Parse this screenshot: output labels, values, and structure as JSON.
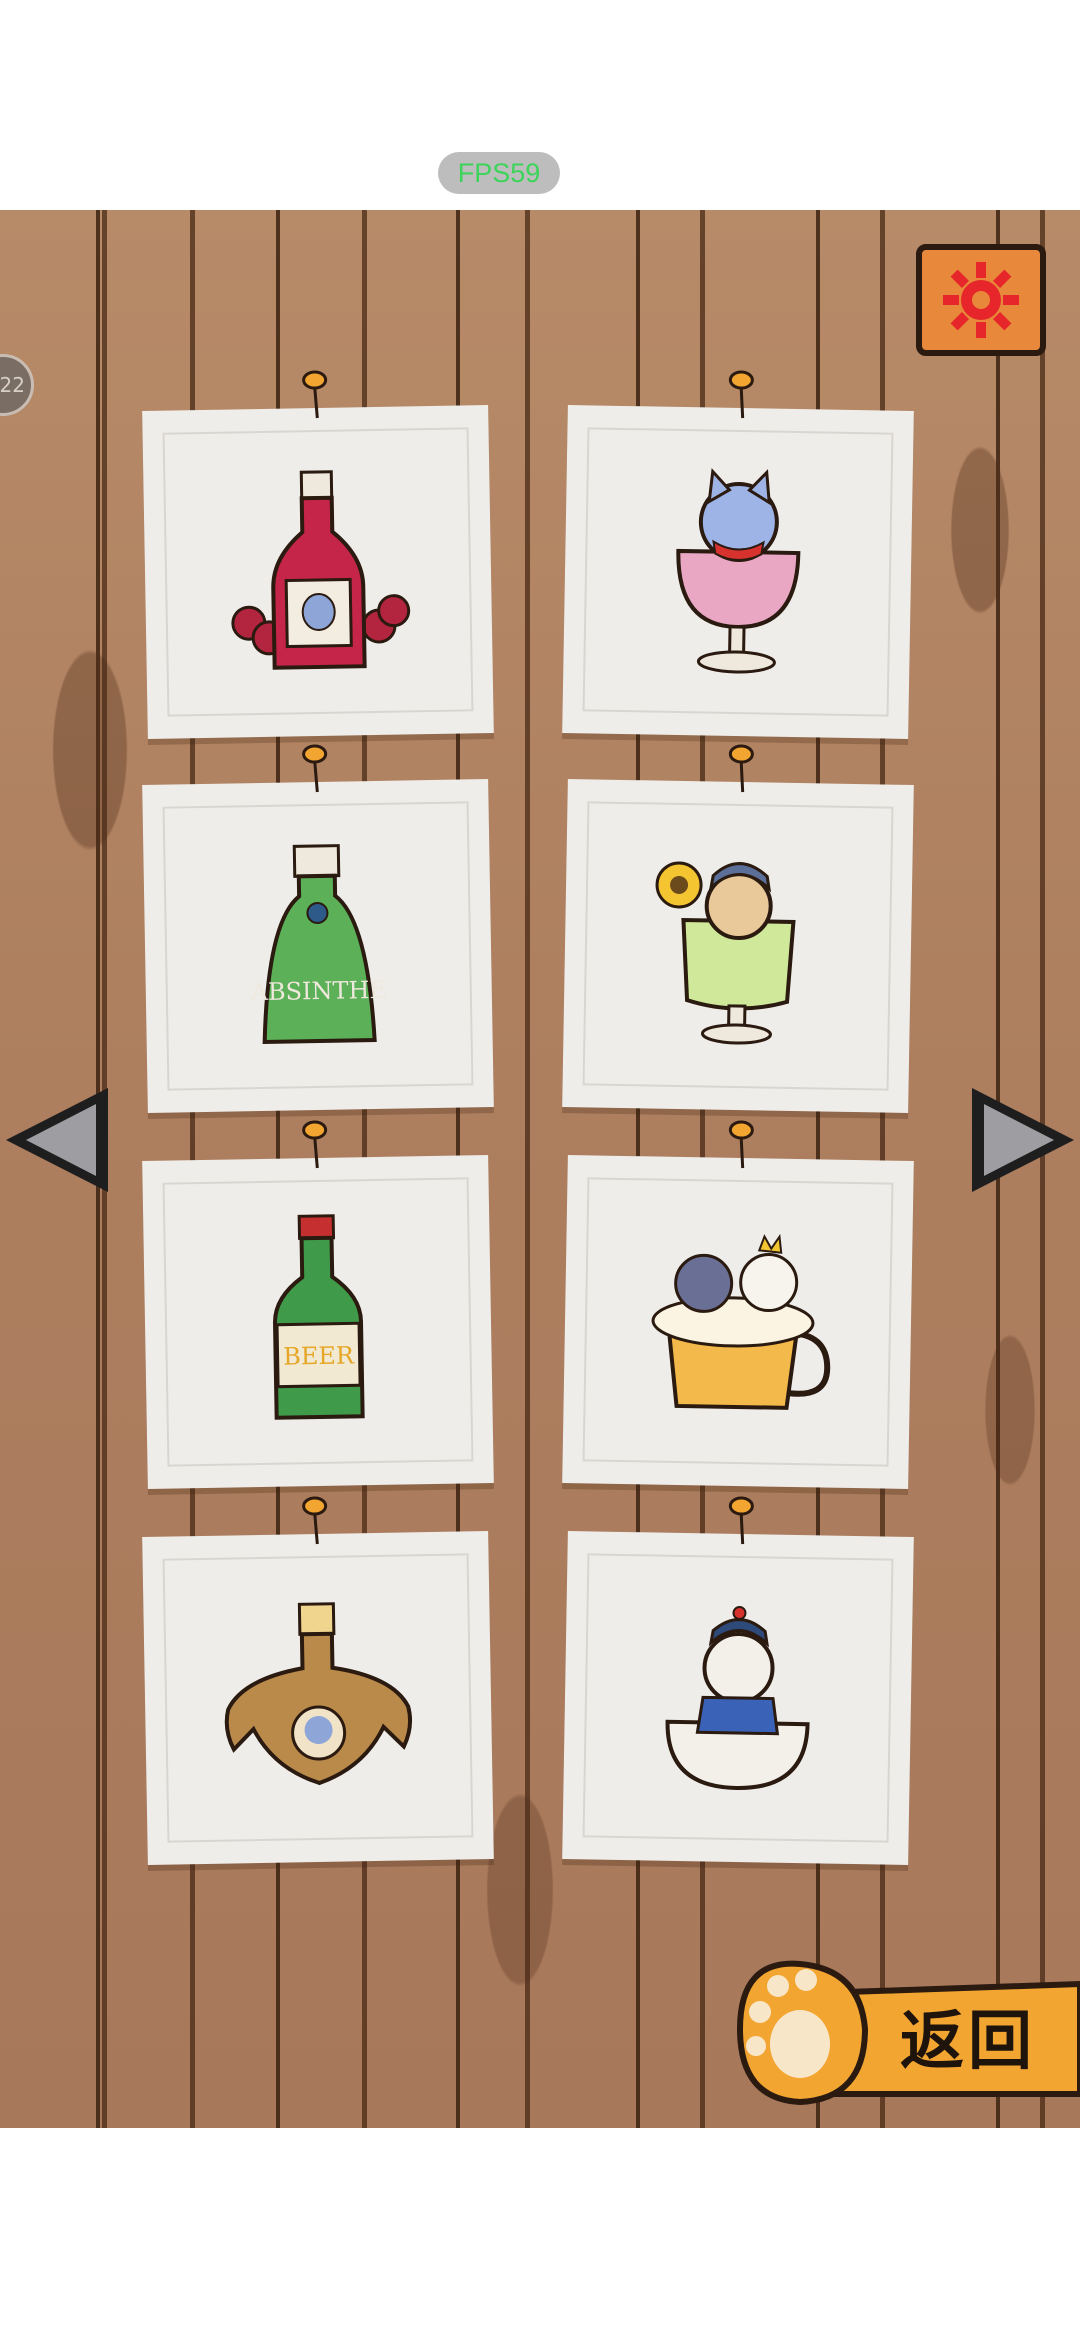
{
  "status": {
    "fps_text": "FPS59"
  },
  "side_badge": {
    "text": "22"
  },
  "back_button": {
    "label": "返回"
  },
  "cards": [
    {
      "name": "red-wine-card",
      "art": "red-wine-bottle"
    },
    {
      "name": "wine-glass-cat-card",
      "art": "cat-in-wine-glass"
    },
    {
      "name": "absinthe-card",
      "art": "absinthe-bottle",
      "art_text": "ABSINTHE"
    },
    {
      "name": "absinthe-glass-cat-card",
      "art": "cat-in-absinthe-glass"
    },
    {
      "name": "beer-card",
      "art": "beer-bottle",
      "art_text": "BEER"
    },
    {
      "name": "beer-mug-cats-card",
      "art": "cats-in-beer-mug"
    },
    {
      "name": "ornate-flask-card",
      "art": "ornate-flask"
    },
    {
      "name": "bowl-cat-card",
      "art": "cat-in-bowl"
    }
  ],
  "colors": {
    "wood": "#ad7f5f",
    "card": "#efedea",
    "fps_text": "#3cd45a",
    "button_orange": "#f2a530",
    "settings_orange": "#e8883a"
  }
}
